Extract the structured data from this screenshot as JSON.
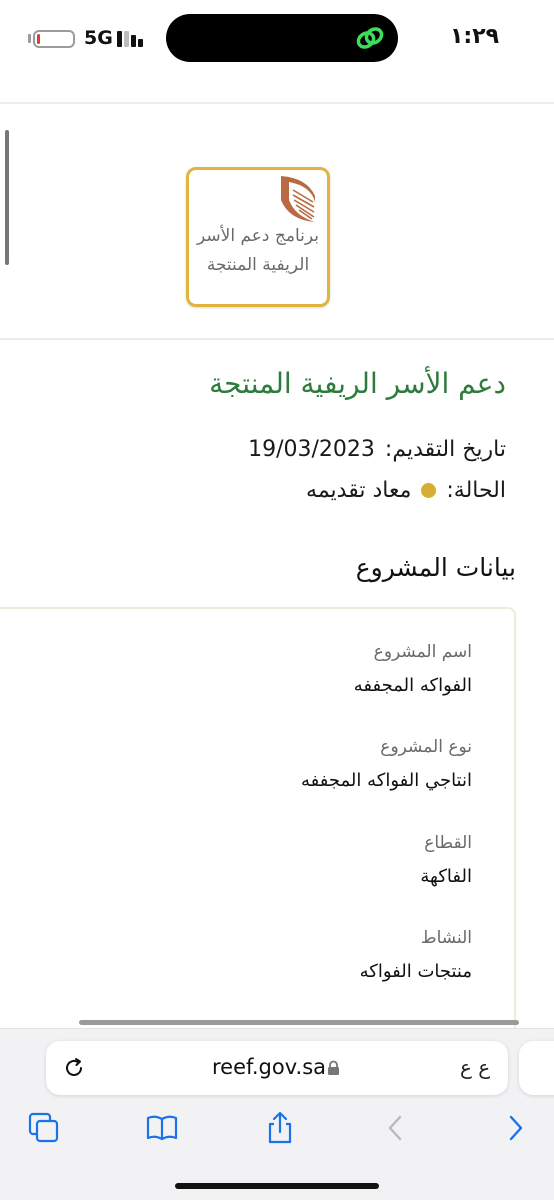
{
  "status_bar": {
    "network": "5G",
    "time": "١:٢٩",
    "battery_level": 0.1
  },
  "logo": {
    "line1": "برنامج دعم الأسر",
    "line2": "الريفية المنتجة"
  },
  "application": {
    "title": "دعم الأسر الريفية المنتجة",
    "date_label": "تاريخ التقديم:",
    "date_value": "19/03/2023",
    "status_label": "الحالة:",
    "status_value": "معاد تقديمه",
    "status_color": "#d8ad33"
  },
  "project": {
    "section_title": "بيانات المشروع",
    "fields": [
      {
        "label": "اسم المشروع",
        "value": "الفواكه المجففه"
      },
      {
        "label": "نوع المشروع",
        "value": "انتاجي الفواكه المجففه"
      },
      {
        "label": "القطاع",
        "value": "الفاكهة"
      },
      {
        "label": "النشاط",
        "value": "منتجات الفواكه"
      }
    ]
  },
  "browser": {
    "url": "reef.gov.sa",
    "text_size_button": "ع ع",
    "accent": "#1a73e8"
  }
}
